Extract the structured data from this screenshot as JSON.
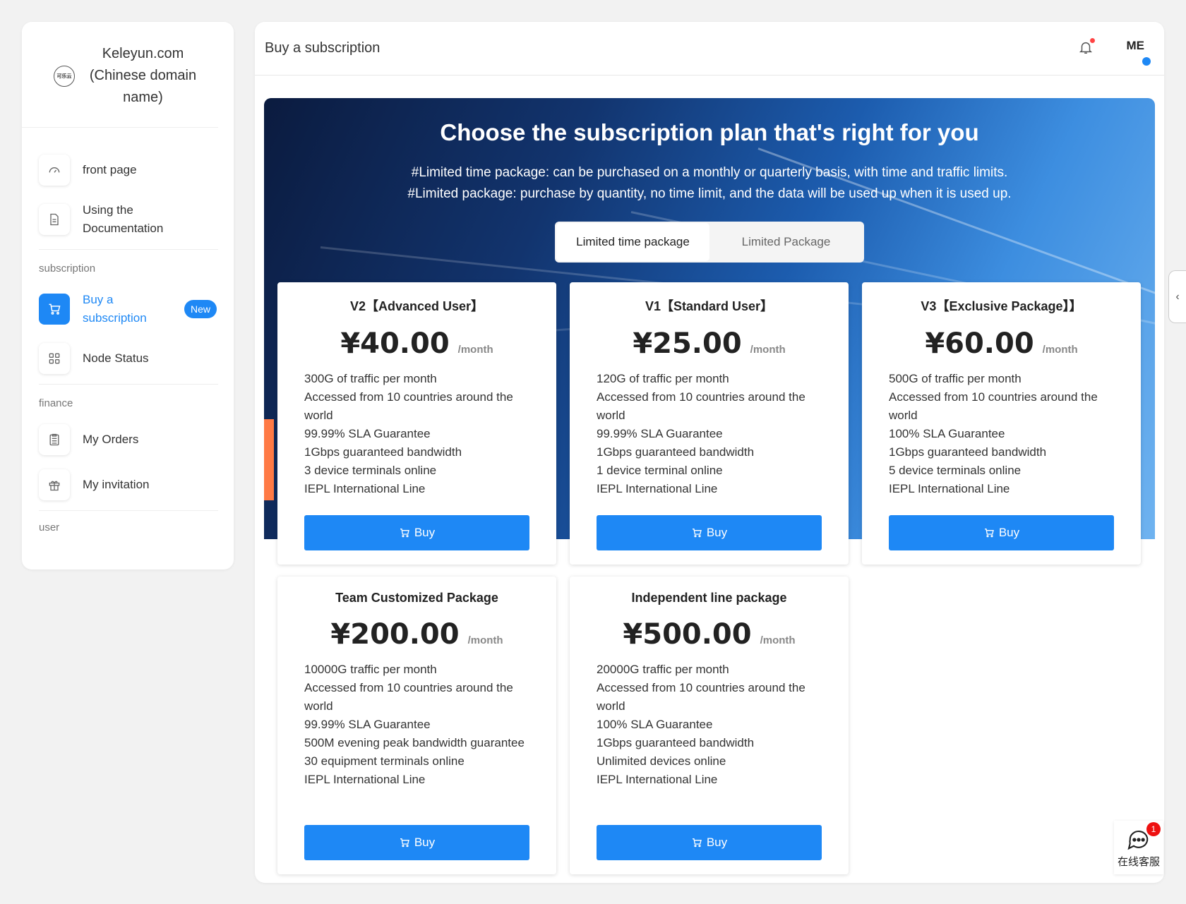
{
  "sidebar": {
    "brand": {
      "logo_text": "可乐云",
      "name": "Keleyun.com (Chinese domain name)"
    },
    "items": [
      {
        "label": "front page",
        "icon": "dashboard-icon"
      },
      {
        "label": "Using the Documentation",
        "icon": "document-icon"
      }
    ],
    "sections": [
      {
        "label": "subscription"
      },
      {
        "label": "finance"
      },
      {
        "label": "user"
      }
    ],
    "subscription_items": [
      {
        "label": "Buy a subscription",
        "icon": "cart-icon",
        "badge": "New",
        "active": true
      },
      {
        "label": "Node Status",
        "icon": "grid-icon"
      }
    ],
    "finance_items": [
      {
        "label": "My Orders",
        "icon": "clipboard-icon"
      },
      {
        "label": "My invitation",
        "icon": "gift-icon"
      }
    ]
  },
  "header": {
    "title": "Buy a subscription",
    "user_initials": "ME"
  },
  "hero": {
    "title": "Choose the subscription plan that's right for you",
    "line1": "#Limited time package: can be purchased on a monthly or quarterly basis, with time and traffic limits.",
    "line2": "#Limited package: purchase by quantity, no time limit, and the data will be used up when it is used up.",
    "tabs": [
      {
        "label": "Limited time package",
        "active": true
      },
      {
        "label": "Limited Package",
        "active": false
      }
    ]
  },
  "plans": [
    {
      "title": "V2【Advanced User】",
      "price": "¥40.00",
      "per": "/month",
      "features": [
        "300G of traffic per month",
        "Accessed from 10 countries around the world",
        "99.99% SLA Guarantee",
        "1Gbps guaranteed bandwidth",
        "3 device terminals online",
        "IEPL International Line"
      ],
      "button": "Buy"
    },
    {
      "title": "V1【Standard User】",
      "price": "¥25.00",
      "per": "/month",
      "features": [
        "120G of traffic per month",
        "Accessed from 10 countries around the world",
        "99.99% SLA Guarantee",
        "1Gbps guaranteed bandwidth",
        "1 device terminal online",
        "IEPL International Line"
      ],
      "button": "Buy"
    },
    {
      "title": "V3【Exclusive Package】】",
      "price": "¥60.00",
      "per": "/month",
      "features": [
        "500G of traffic per month",
        "Accessed from 10 countries around the world",
        "100% SLA Guarantee",
        "1Gbps guaranteed bandwidth",
        "5 device terminals online",
        "IEPL International Line"
      ],
      "button": "Buy"
    },
    {
      "title": "Team Customized Package",
      "price": "¥200.00",
      "per": "/month",
      "features": [
        "10000G traffic per month",
        "Accessed from 10 countries around the world",
        "99.99% SLA Guarantee",
        "500M evening peak bandwidth guarantee",
        "30 equipment terminals online",
        "IEPL International Line"
      ],
      "button": "Buy"
    },
    {
      "title": "Independent line package",
      "price": "¥500.00",
      "per": "/month",
      "features": [
        "20000G traffic per month",
        "Accessed from 10 countries around the world",
        "100% SLA Guarantee",
        "1Gbps guaranteed bandwidth",
        "Unlimited devices online",
        "IEPL International Line"
      ],
      "button": "Buy"
    }
  ],
  "support": {
    "label": "在线客服",
    "badge": "1"
  },
  "colors": {
    "accent": "#1e88f5",
    "alert": "#ff4444"
  }
}
